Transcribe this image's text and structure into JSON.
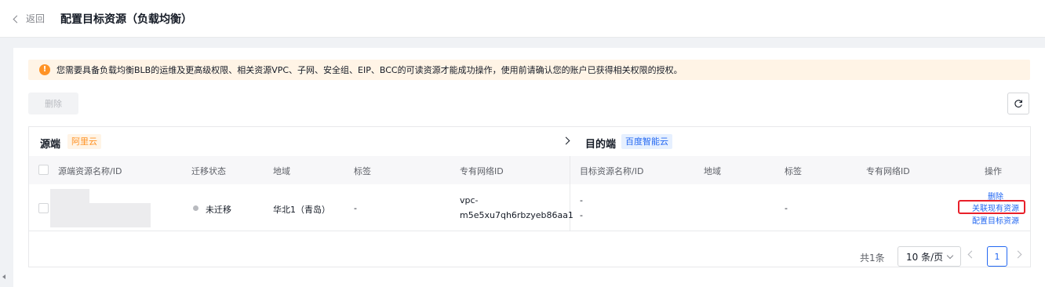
{
  "header": {
    "back_label": "返回",
    "title": "配置目标资源（负载均衡）"
  },
  "alert": {
    "icon": "warning-icon",
    "text": "您需要具备负载均衡BLB的运维及更高级权限、相关资源VPC、子网、安全组、EIP、BCC的可读资源才能成功操作，使用前请确认您的账户已获得相关权限的授权。"
  },
  "toolbar": {
    "delete_label": "删除"
  },
  "table": {
    "source_label": "源端",
    "source_cloud": "阿里云",
    "target_label": "目的端",
    "target_cloud": "百度智能云",
    "columns": [
      "源端资源名称/ID",
      "迁移状态",
      "地域",
      "标签",
      "专有网络ID",
      "目标资源名称/ID",
      "地域",
      "标签",
      "专有网络ID",
      "操作"
    ],
    "rows": [
      {
        "status": "未迁移",
        "region": "华北1（青岛）",
        "tags": "-",
        "vpc_line1": "vpc-",
        "vpc_line2": "m5e5xu7qh6rbzyeb86aa1",
        "target_name": "-",
        "target_id": "-",
        "target_tags": "-",
        "actions": [
          "删除",
          "关联现有资源",
          "配置目标资源"
        ]
      }
    ]
  },
  "pagination": {
    "total": "共1条",
    "page_size": "10 条/页",
    "current_page": "1"
  },
  "colors": {
    "primary": "#2468f2",
    "warning": "#ff9326",
    "highlight": "#e8202a"
  }
}
